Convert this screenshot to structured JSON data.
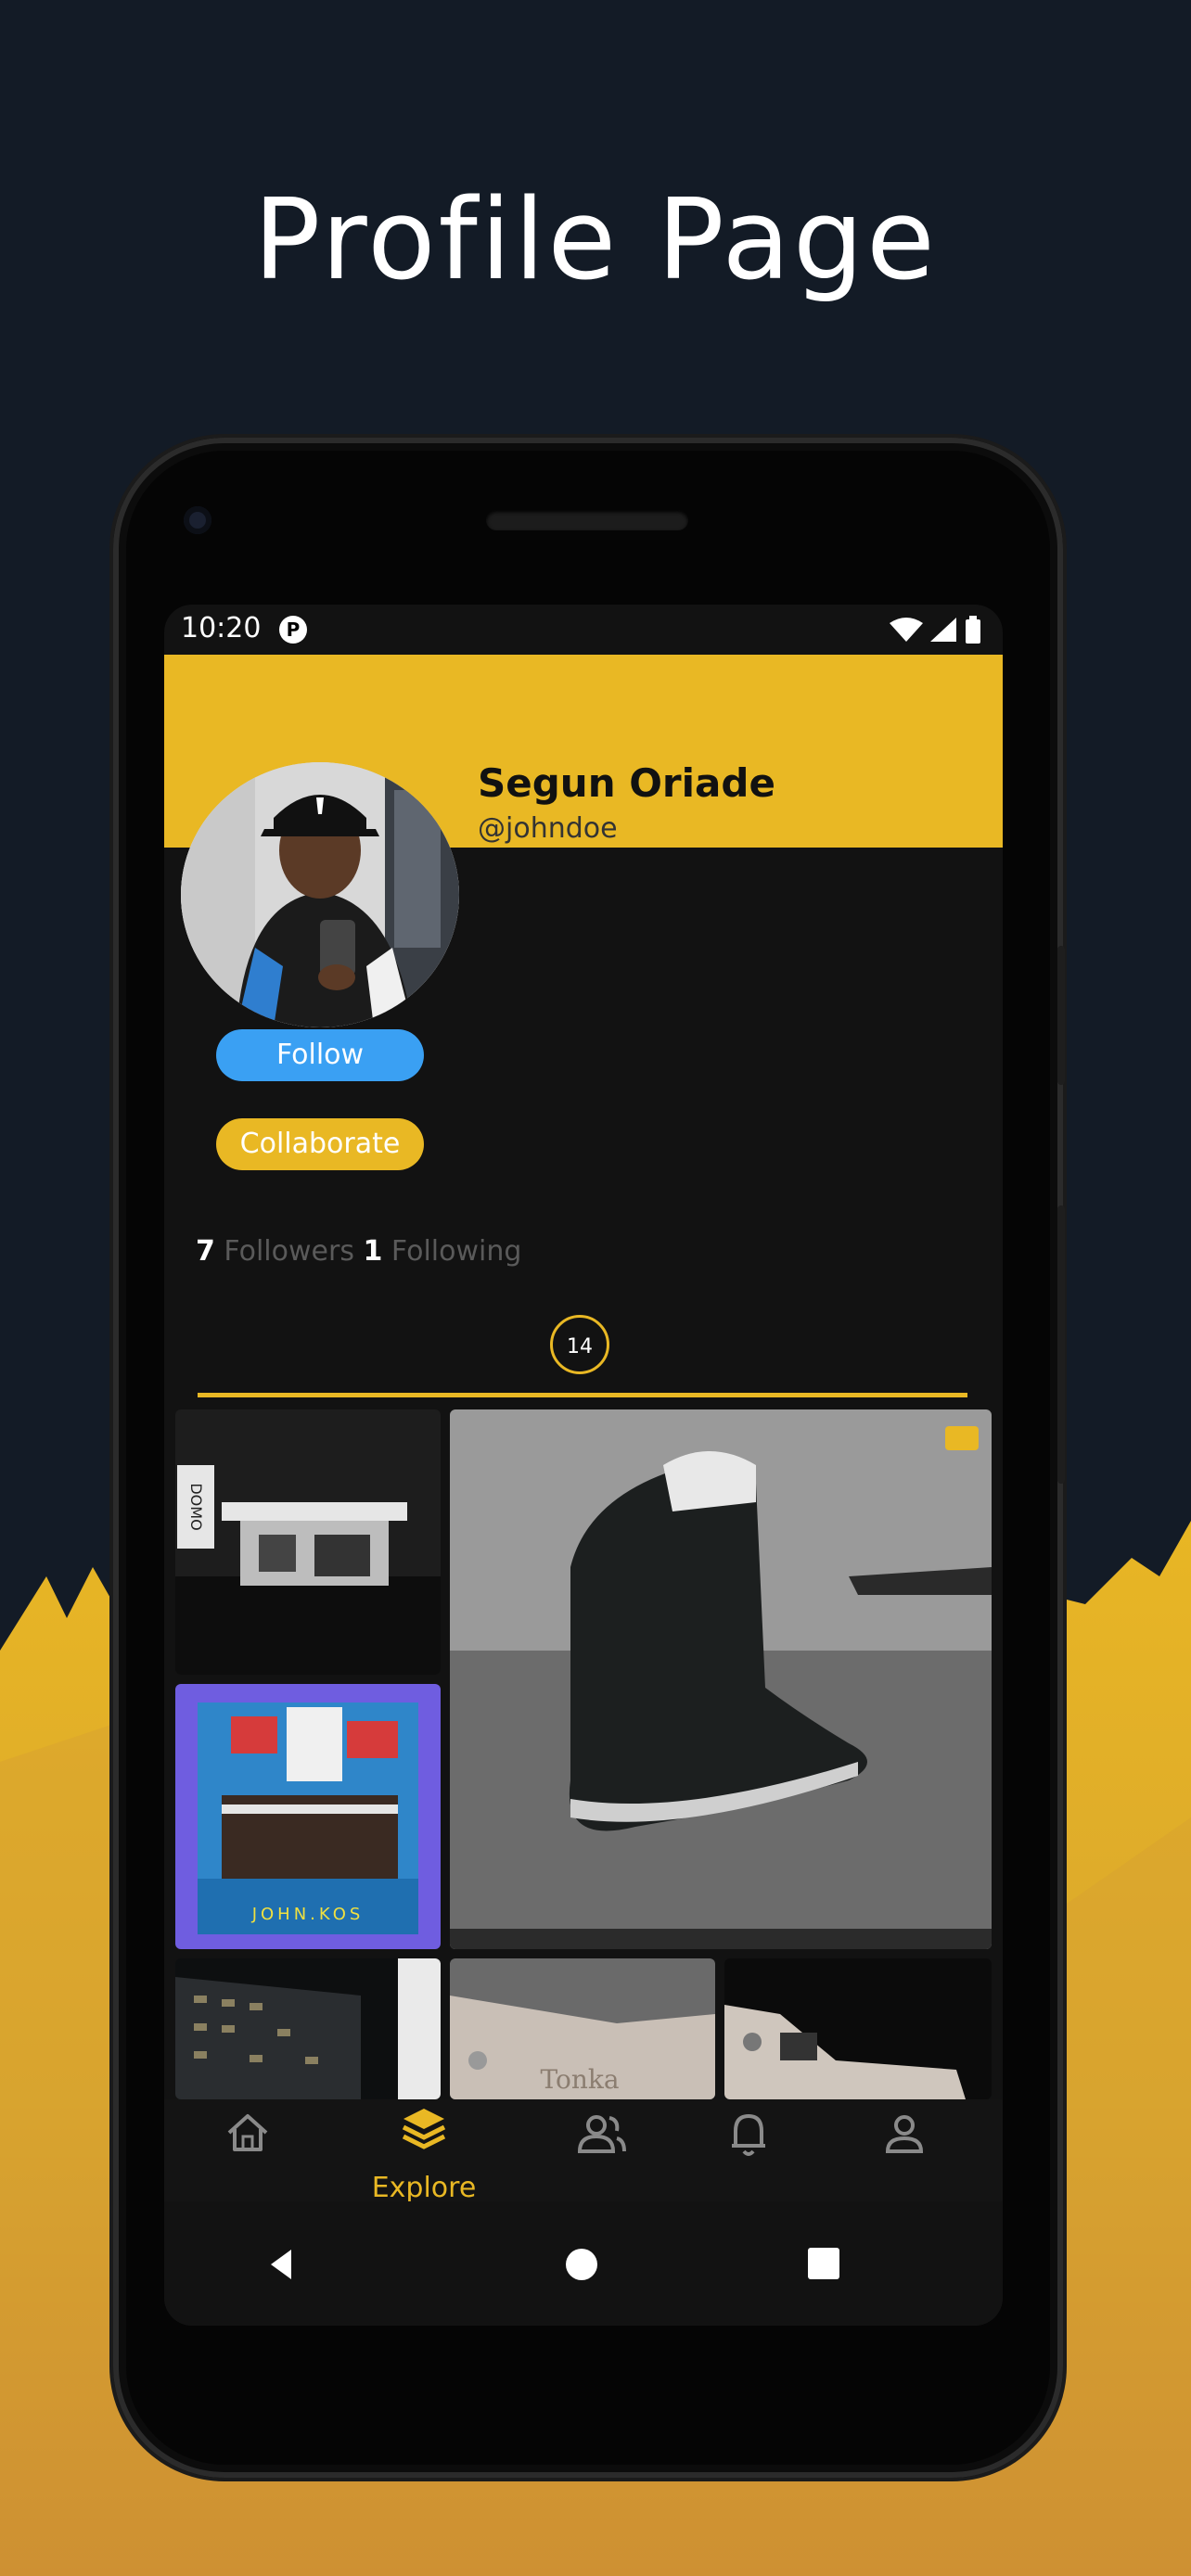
{
  "headline": "Profile Page",
  "status": {
    "time": "10:20",
    "badge": "P"
  },
  "profile": {
    "name": "Segun Oriade",
    "handle": "@johndoe",
    "follow_label": "Follow",
    "collaborate_label": "Collaborate",
    "followers_count": "7",
    "followers_label": "Followers",
    "following_count": "1",
    "following_label": "Following",
    "posts_count": "14"
  },
  "gallery": {
    "tile2_sign": "DOMO",
    "tile3_caption": "JOHN.KOS",
    "tile6_text": "Tonka"
  },
  "nav": {
    "items": [
      "home",
      "explore",
      "people",
      "notifications",
      "profile"
    ],
    "active_label": "Explore"
  },
  "colors": {
    "accent": "#e9b824",
    "follow": "#3aa0f3",
    "background": "#131b26"
  }
}
